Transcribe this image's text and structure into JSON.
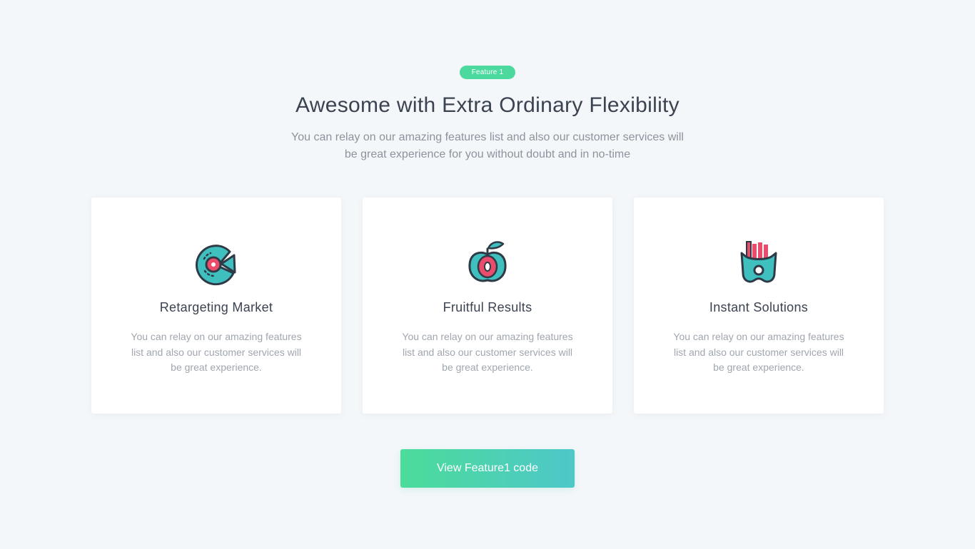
{
  "section": {
    "badge": "Feature 1",
    "title": "Awesome with Extra Ordinary Flexibility",
    "subtitle_line1": "You can relay on our amazing features list and also our customer services will",
    "subtitle_line2": "be great experience for you without doubt and in no-time"
  },
  "cards": [
    {
      "icon": "target-pie-icon",
      "title": "Retargeting Market",
      "desc_line1": "You can relay on our amazing features",
      "desc_line2": "list and also our customer services will",
      "desc_line3": "be great experience."
    },
    {
      "icon": "apple-icon",
      "title": "Fruitful Results",
      "desc_line1": "You can relay on our amazing features",
      "desc_line2": "list and also our customer services will",
      "desc_line3": "be great experience."
    },
    {
      "icon": "fries-icon",
      "title": "Instant Solutions",
      "desc_line1": "You can relay on our amazing features",
      "desc_line2": "list and also our customer services will",
      "desc_line3": "be great experience."
    }
  ],
  "button": {
    "label": "View Feature1 code"
  },
  "colors": {
    "background": "#f4f7fa",
    "accent_green": "#4cd99e",
    "accent_teal": "#4ec7c9",
    "icon_teal": "#3fbfbe",
    "icon_red": "#ea4c6c",
    "icon_outline": "#2f3a47",
    "heading": "#3b4350",
    "muted_text": "#8c939c"
  }
}
